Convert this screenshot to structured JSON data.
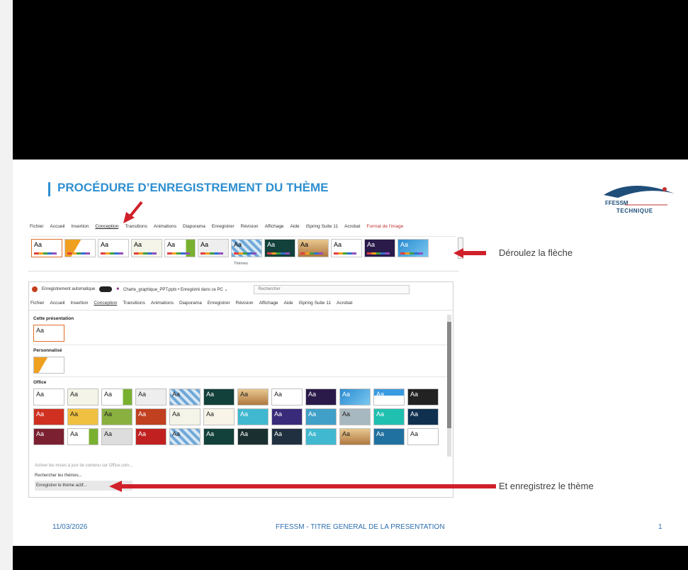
{
  "slide": {
    "title": "PROCÉDURE D’ENREGISTREMENT DU THÈME",
    "logo_text": "FFESSM",
    "logo_sub": "TECHNIQUE",
    "instruction_1": "Déroulez la flèche",
    "instruction_2": "Et enregistrez le thème",
    "footer_date": "11/03/2026",
    "footer_title": "FFESSM - TITRE GENERAL DE LA PRESENTATION",
    "footer_page": "1"
  },
  "ribbon1": {
    "menu": [
      "Fichier",
      "Accueil",
      "Insertion",
      "Conception",
      "Transitions",
      "Animations",
      "Diaporama",
      "Enregistrer",
      "Révision",
      "Affichage",
      "Aide",
      "iSpring Suite 11",
      "Acrobat",
      "Format de l'image"
    ],
    "strip_label": "Thèmes",
    "thumbs": [
      "Aa",
      "",
      "Aa",
      "Aa",
      "Aa",
      "Aa",
      "Aa",
      "Aa",
      "Aa",
      "Aa",
      "Aa",
      "Aa",
      "Aa"
    ]
  },
  "window2": {
    "autosave": "Enregistrement automatique",
    "filename": "Charte_graphique_PPT.pptx • Enregistré dans ce PC ⌄",
    "search_placeholder": "Rechercher",
    "menu": [
      "Fichier",
      "Accueil",
      "Insertion",
      "Conception",
      "Transitions",
      "Animations",
      "Diaporama",
      "Enregistrer",
      "Révision",
      "Affichage",
      "Aide",
      "iSpring Suite 11",
      "Acrobat"
    ],
    "section_current": "Cette présentation",
    "section_custom": "Personnalisé",
    "section_office": "Office",
    "link_update": "Activer les mises à jour de contenu sur Office.com...",
    "link_browse": "Rechercher les thèmes...",
    "link_save": "Enregistrer le thème actif..."
  },
  "colors": {
    "accent": "#2f8fd0",
    "arrow": "#d0202a",
    "footer": "#2f6fb0"
  },
  "icons": [
    "powerpoint-icon",
    "save-icon",
    "search-icon",
    "arrow-left-icon",
    "arrow-down-icon"
  ]
}
